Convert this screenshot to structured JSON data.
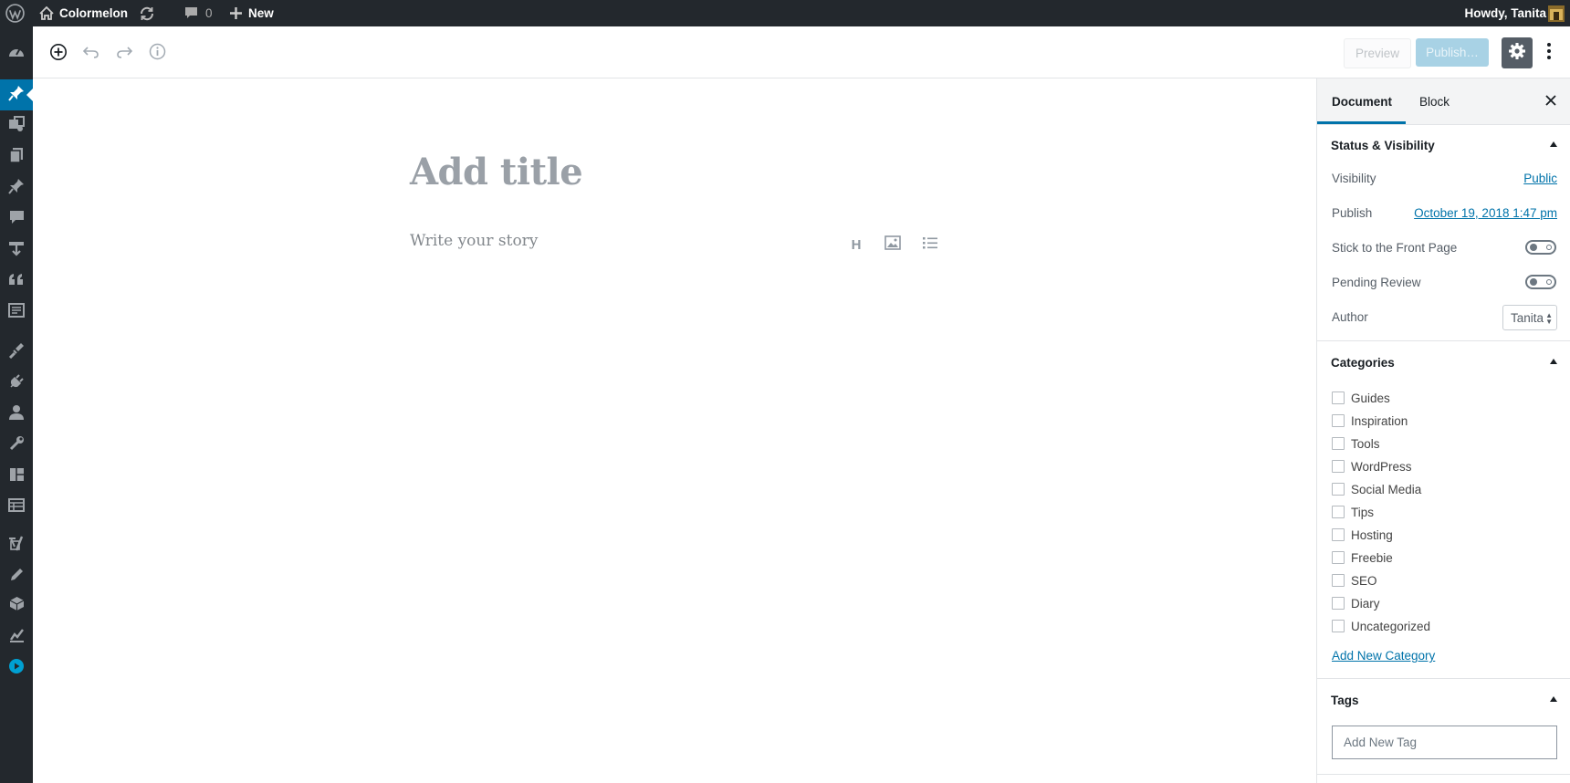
{
  "adminbar": {
    "site_name": "Colormelon",
    "comments_count": "0",
    "new_label": "New",
    "greeting": "Howdy, Tanita"
  },
  "adminmenu": {
    "icons": [
      "dashboard-icon",
      "posts-icon",
      "media-icon",
      "pages-icon",
      "portfolio-icon",
      "comments-icon",
      "downloads-icon",
      "testimonials-icon",
      "forms-icon",
      "appearance-icon",
      "plugins-icon",
      "users-icon",
      "tools-icon",
      "layouts-icon",
      "tables-icon",
      "yoast-icon",
      "edit-icon",
      "box-icon",
      "stats-icon",
      "play-icon"
    ],
    "current": "posts-icon",
    "accent": "#0073aa",
    "play_color": "#00a0d2"
  },
  "header": {
    "preview_label": "Preview",
    "publish_label": "Publish…"
  },
  "editor": {
    "title_placeholder": "Add title",
    "body_placeholder": "Write your story"
  },
  "sidebar": {
    "tabs": [
      {
        "label": "Document",
        "active": true
      },
      {
        "label": "Block",
        "active": false
      }
    ],
    "status_panel": {
      "title": "Status & Visibility",
      "visibility_label": "Visibility",
      "visibility_value": "Public",
      "publish_label": "Publish",
      "publish_value": "October 19, 2018 1:47 pm",
      "sticky_label": "Stick to the Front Page",
      "sticky_on": false,
      "pending_label": "Pending Review",
      "pending_on": false,
      "author_label": "Author",
      "author_value": "Tanita"
    },
    "categories_panel": {
      "title": "Categories",
      "items": [
        "Guides",
        "Inspiration",
        "Tools",
        "WordPress",
        "Social Media",
        "Tips",
        "Hosting",
        "Freebie",
        "SEO",
        "Diary",
        "Uncategorized"
      ],
      "add_new": "Add New Category"
    },
    "tags_panel": {
      "title": "Tags",
      "input_placeholder": "Add New Tag"
    }
  }
}
